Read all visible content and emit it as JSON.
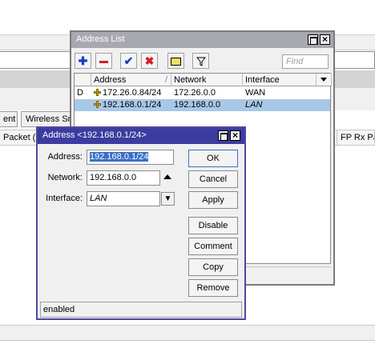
{
  "background": {
    "tabs": [
      "ent",
      "Wireless Sn"
    ],
    "column_header": "Packet (p",
    "column_header_right": "FP Rx Pa"
  },
  "address_list": {
    "title": "Address List",
    "find_placeholder": "Find",
    "columns": {
      "flag": "",
      "address": "Address",
      "network": "Network",
      "interface": "Interface"
    },
    "rows": [
      {
        "flag": "D",
        "address": "172.26.0.84/24",
        "network": "172.26.0.0",
        "interface": "WAN",
        "selected": false
      },
      {
        "flag": "",
        "address": "192.168.0.1/24",
        "network": "192.168.0.0",
        "interface": "LAN",
        "selected": true
      }
    ],
    "toolbar_icons": [
      "add-icon",
      "remove-icon",
      "enable-icon",
      "disable-icon",
      "comment-icon",
      "filter-icon"
    ]
  },
  "address_dialog": {
    "title": "Address <192.168.0.1/24>",
    "address_label": "Address:",
    "address_value": "192.168.0.1/24",
    "network_label": "Network:",
    "network_value": "192.168.0.0",
    "interface_label": "Interface:",
    "interface_value": "LAN",
    "buttons": {
      "ok": "OK",
      "cancel": "Cancel",
      "apply": "Apply",
      "disable": "Disable",
      "comment": "Comment",
      "copy": "Copy",
      "remove": "Remove"
    },
    "status": "enabled"
  }
}
